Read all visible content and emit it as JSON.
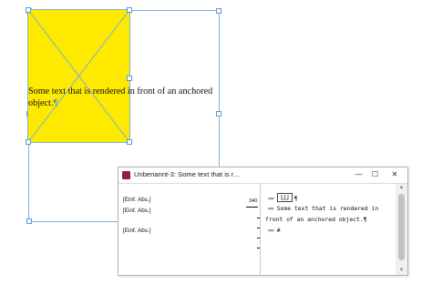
{
  "document": {
    "story_line_1": "Some text that is rendered in front of an anchored",
    "story_line_2": "object.",
    "pilcrow": "¶"
  },
  "story_editor": {
    "title": "Unbenannt-3: Some text that is r...",
    "controls": {
      "minimize": "—",
      "maximize": "☐",
      "close": "✕"
    },
    "ruler_value": "340",
    "paragraph_styles": [
      "[Einf. Abs.]",
      "[Einf. Abs.]",
      "[Einf. Abs.]"
    ],
    "text_lines": {
      "line_1_pilcrow": "¶",
      "line_2": "Some text that is rendered in",
      "line_3": "front of an anchored object.¶",
      "line_4_end": "#"
    },
    "scroll_up": "▲",
    "scroll_down": "▼"
  },
  "colors": {
    "frame_fill": "#fdea00",
    "frame_outline": "#7fb0dc",
    "app_icon": "#9b1c3a"
  },
  "icons": [
    "anchored-object-icon",
    "app-icon",
    "minimize-icon",
    "maximize-icon",
    "close-icon"
  ]
}
